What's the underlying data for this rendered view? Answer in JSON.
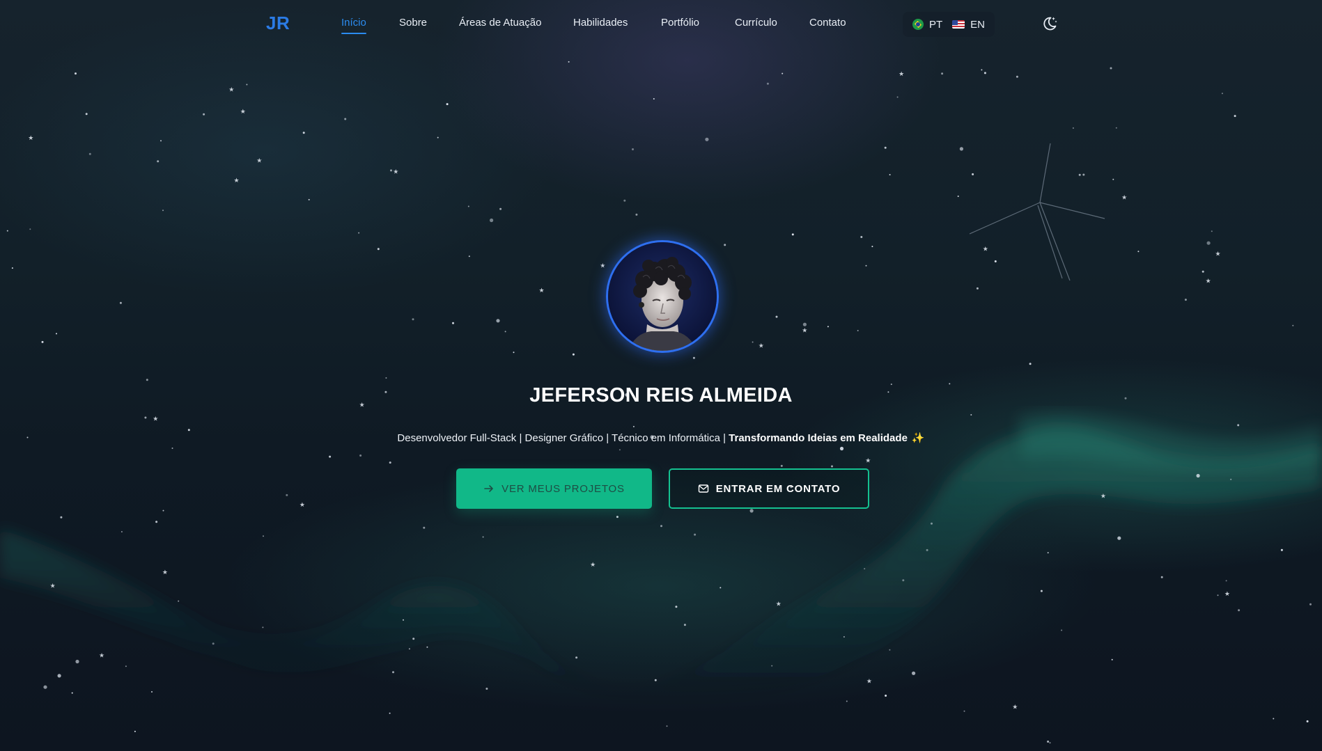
{
  "nav": {
    "logo": "JR",
    "links": [
      "Início",
      "Sobre",
      "Áreas de Atuação",
      "Habilidades",
      "Portfólio",
      "Currículo",
      "Contato"
    ],
    "active_index": 0
  },
  "language": {
    "pt_label": "PT",
    "en_label": "EN",
    "pt_flag_icon": "brazil-flag-icon",
    "en_flag_icon": "us-flag-icon"
  },
  "theme_toggle_icon": "moon-stars-icon",
  "hero": {
    "name": "JEFERSON REIS ALMEIDA",
    "tagline_prefix": "Desenvolvedor Full-Stack | Designer Gráfico | Técnico em Informática | ",
    "tagline_highlight": "Transformando Ideias em Realidade",
    "tagline_emoji": "✨",
    "primary_button": "VER MEUS PROJETOS",
    "secondary_button": "ENTRAR EM CONTATO"
  },
  "colors": {
    "accent_blue": "#2b8cf0",
    "accent_green": "#11b888",
    "background": "#0e1522"
  }
}
